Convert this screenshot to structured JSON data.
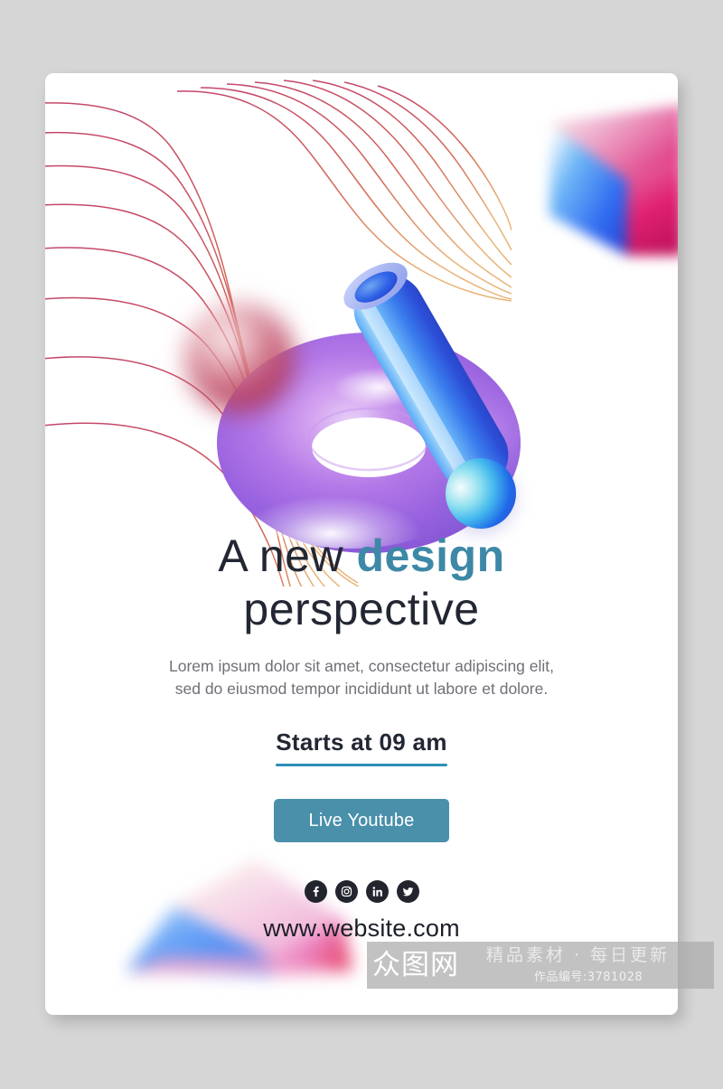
{
  "canvas": {
    "background_color": "#d6d6d6",
    "card_background": "#ffffff"
  },
  "poster": {
    "headline": {
      "line1_prefix": "A new ",
      "line1_accent": "design",
      "line2": "perspective",
      "text_color": "#222733",
      "accent_color": "#3d88a6"
    },
    "subcopy": "Lorem ipsum dolor sit amet, consectetur adipiscing elit, sed do eiusmod tempor incididunt ut labore et dolore.",
    "schedule": {
      "label": "Starts at 09 am",
      "underline_color": "#2b8fb5"
    },
    "cta": {
      "label": "Live Youtube",
      "background_color": "#4a90ab",
      "text_color": "#ffffff"
    },
    "website": "www.website.com",
    "social": [
      {
        "name": "facebook",
        "icon": "facebook-icon",
        "label": "Facebook"
      },
      {
        "name": "instagram",
        "icon": "instagram-icon",
        "label": "Instagram"
      },
      {
        "name": "linkedin",
        "icon": "linkedin-icon",
        "label": "LinkedIn"
      },
      {
        "name": "twitter",
        "icon": "twitter-icon",
        "label": "Twitter"
      }
    ]
  },
  "artwork": {
    "flow_lines": {
      "name": "flow-lines-decoration",
      "stroke_top_color": "#c03c62",
      "stroke_bottom_color": "#e0a05c"
    },
    "torus": {
      "name": "purple-torus",
      "color_light": "#d7a7ef",
      "color_mid": "#a77de4",
      "color_dark": "#7a52c8"
    },
    "cylinder": {
      "name": "blue-cylinder",
      "color_light": "#7fc4f7",
      "color_mid": "#3f86ef",
      "color_dark": "#2a4fd6",
      "rim_color": "#aeb9f2"
    },
    "red_sphere": {
      "name": "blurred-red-sphere",
      "color": "#bf4966"
    },
    "blue_sphere": {
      "name": "cyan-blue-sphere",
      "color_light": "#8fe0ef",
      "color_dark": "#2d4fd6"
    },
    "prism_top_right": {
      "name": "prism-top-right",
      "face_pink": "#e03a84",
      "face_blue": "#2f6af0"
    },
    "prism_bottom_left": {
      "name": "prism-bottom-left",
      "face_pink": "#ef9ecb",
      "face_blue": "#4f8ef5"
    }
  },
  "watermark": {
    "logo_text": "众图网",
    "tagline": "精品素材 · 每日更新",
    "code": "作品编号:3781028",
    "overlay_color": "#aaaaaa"
  }
}
